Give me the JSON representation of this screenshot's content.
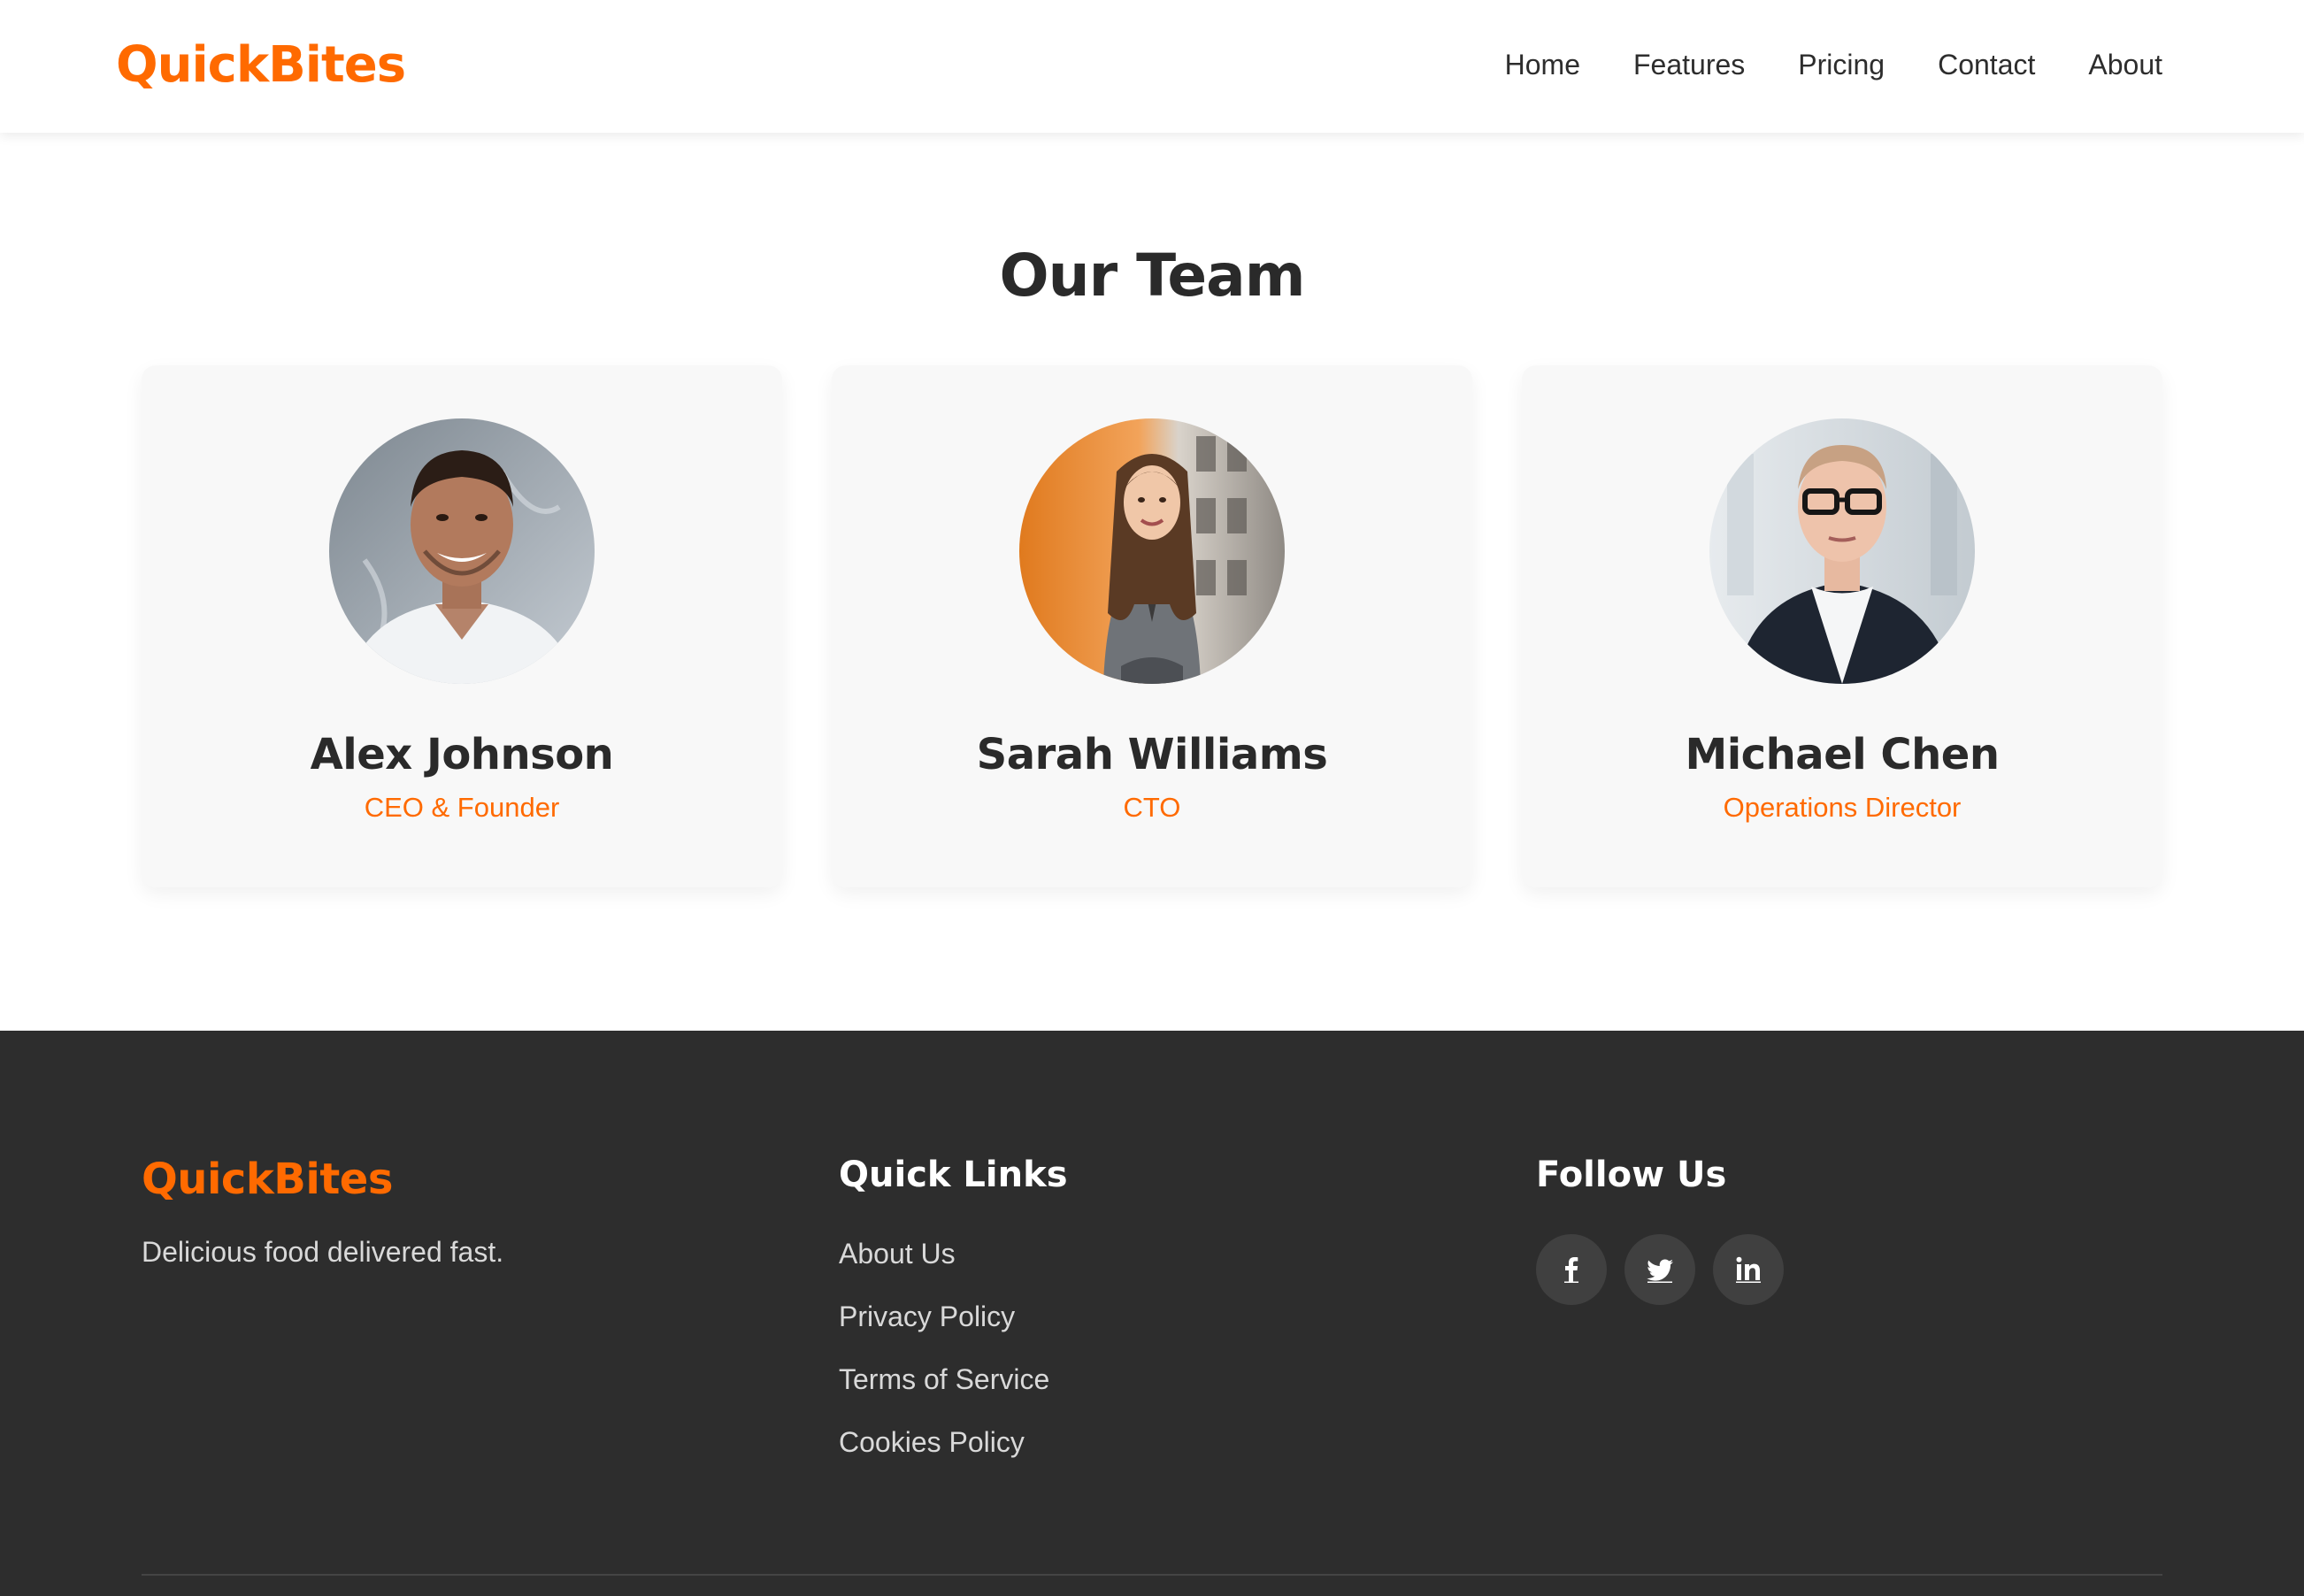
{
  "colors": {
    "brand": "#ff6a00",
    "text_dark": "#2a2a2a",
    "footer_bg": "#2d2d2d",
    "card_bg": "#f8f8f8"
  },
  "header": {
    "brand": "QuickBites",
    "nav": [
      "Home",
      "Features",
      "Pricing",
      "Contact",
      "About"
    ]
  },
  "team": {
    "title": "Our Team",
    "members": [
      {
        "name": "Alex Johnson",
        "role": "CEO & Founder",
        "photo": "portrait-photo"
      },
      {
        "name": "Sarah Williams",
        "role": "CTO",
        "photo": "portrait-photo"
      },
      {
        "name": "Michael Chen",
        "role": "Operations Director",
        "photo": "portrait-photo"
      }
    ]
  },
  "footer": {
    "brand": "QuickBites",
    "tagline": "Delicious food delivered fast.",
    "quick_links_title": "Quick Links",
    "quick_links": [
      "About Us",
      "Privacy Policy",
      "Terms of Service",
      "Cookies Policy"
    ],
    "follow_title": "Follow Us",
    "social": [
      "facebook-icon",
      "twitter-icon",
      "linkedin-icon"
    ]
  }
}
